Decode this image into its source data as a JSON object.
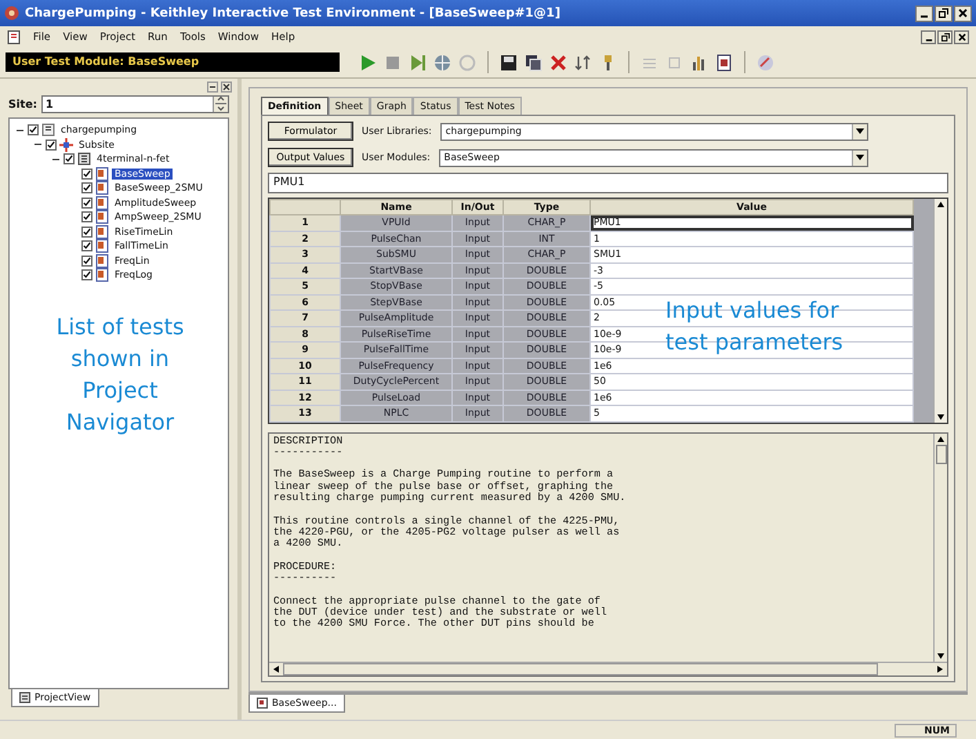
{
  "window": {
    "title": "ChargePumping - Keithley Interactive Test Environment - [BaseSweep#1@1]"
  },
  "menu": [
    "File",
    "View",
    "Project",
    "Run",
    "Tools",
    "Window",
    "Help"
  ],
  "toolbar": {
    "module_display": "User Test Module: BaseSweep"
  },
  "navigator": {
    "site_label": "Site:",
    "site_value": "1",
    "tab": "ProjectView",
    "tree": [
      {
        "label": "chargepumping",
        "kind": "project",
        "checked": true,
        "expanded": true,
        "selected": false,
        "children": [
          {
            "label": "Subsite",
            "kind": "subsite",
            "checked": true,
            "expanded": true,
            "selected": false,
            "children": [
              {
                "label": "4terminal-n-fet",
                "kind": "device",
                "checked": true,
                "expanded": true,
                "selected": false,
                "children": [
                  {
                    "label": "BaseSweep",
                    "kind": "test",
                    "checked": true,
                    "selected": true
                  },
                  {
                    "label": "BaseSweep_2SMU",
                    "kind": "test",
                    "checked": true,
                    "selected": false
                  },
                  {
                    "label": "AmplitudeSweep",
                    "kind": "test",
                    "checked": true,
                    "selected": false
                  },
                  {
                    "label": "AmpSweep_2SMU",
                    "kind": "test",
                    "checked": true,
                    "selected": false
                  },
                  {
                    "label": "RiseTimeLin",
                    "kind": "test",
                    "checked": true,
                    "selected": false
                  },
                  {
                    "label": "FallTimeLin",
                    "kind": "test",
                    "checked": true,
                    "selected": false
                  },
                  {
                    "label": "FreqLin",
                    "kind": "test",
                    "checked": true,
                    "selected": false
                  },
                  {
                    "label": "FreqLog",
                    "kind": "test",
                    "checked": true,
                    "selected": false
                  }
                ]
              }
            ]
          }
        ]
      }
    ]
  },
  "annotations": {
    "navigator_note": "List of tests shown in Project Navigator",
    "values_note": "Input values for test parameters"
  },
  "tabs": [
    {
      "label": "Definition",
      "selected": true
    },
    {
      "label": "Sheet",
      "selected": false
    },
    {
      "label": "Graph",
      "selected": false
    },
    {
      "label": "Status",
      "selected": false
    },
    {
      "label": "Test Notes",
      "selected": false
    }
  ],
  "definition": {
    "formulator_button": "Formulator",
    "output_values_button": "Output Values",
    "libraries_label": "User Libraries:",
    "libraries_value": "chargepumping",
    "modules_label": "User Modules:",
    "modules_value": "BaseSweep",
    "name_field": "PMU1"
  },
  "table": {
    "columns": [
      "Name",
      "In/Out",
      "Type",
      "Value"
    ],
    "rows": [
      {
        "num": "1",
        "name": "VPUId",
        "inout": "Input",
        "type": "CHAR_P",
        "value": "PMU1",
        "selected": true
      },
      {
        "num": "2",
        "name": "PulseChan",
        "inout": "Input",
        "type": "INT",
        "value": "1",
        "selected": false
      },
      {
        "num": "3",
        "name": "SubSMU",
        "inout": "Input",
        "type": "CHAR_P",
        "value": "SMU1",
        "selected": false
      },
      {
        "num": "4",
        "name": "StartVBase",
        "inout": "Input",
        "type": "DOUBLE",
        "value": "-3",
        "selected": false
      },
      {
        "num": "5",
        "name": "StopVBase",
        "inout": "Input",
        "type": "DOUBLE",
        "value": "-5",
        "selected": false
      },
      {
        "num": "6",
        "name": "StepVBase",
        "inout": "Input",
        "type": "DOUBLE",
        "value": "0.05",
        "selected": false
      },
      {
        "num": "7",
        "name": "PulseAmplitude",
        "inout": "Input",
        "type": "DOUBLE",
        "value": "2",
        "selected": false
      },
      {
        "num": "8",
        "name": "PulseRiseTime",
        "inout": "Input",
        "type": "DOUBLE",
        "value": "10e-9",
        "selected": false
      },
      {
        "num": "9",
        "name": "PulseFallTime",
        "inout": "Input",
        "type": "DOUBLE",
        "value": "10e-9",
        "selected": false
      },
      {
        "num": "10",
        "name": "PulseFrequency",
        "inout": "Input",
        "type": "DOUBLE",
        "value": "1e6",
        "selected": false
      },
      {
        "num": "11",
        "name": "DutyCyclePercent",
        "inout": "Input",
        "type": "DOUBLE",
        "value": "50",
        "selected": false
      },
      {
        "num": "12",
        "name": "PulseLoad",
        "inout": "Input",
        "type": "DOUBLE",
        "value": "1e6",
        "selected": false
      },
      {
        "num": "13",
        "name": "NPLC",
        "inout": "Input",
        "type": "DOUBLE",
        "value": "5",
        "selected": false
      }
    ]
  },
  "description": [
    "DESCRIPTION\n-----------",
    "The BaseSweep is a Charge Pumping routine to perform a\nlinear sweep of the pulse base or offset, graphing the\nresulting charge pumping current measured by a 4200 SMU.",
    "This routine controls a single channel of the 4225-PMU,\nthe 4220-PGU, or the 4205-PG2 voltage pulser as well as\na 4200 SMU.",
    "PROCEDURE:\n----------",
    "Connect the appropriate pulse channel to the gate of\nthe DUT (device under test) and the substrate or well\nto the 4200 SMU Force. The other DUT pins should be"
  ],
  "document_tab": "BaseSweep...",
  "status_bar": {
    "indicator": "NUM"
  }
}
